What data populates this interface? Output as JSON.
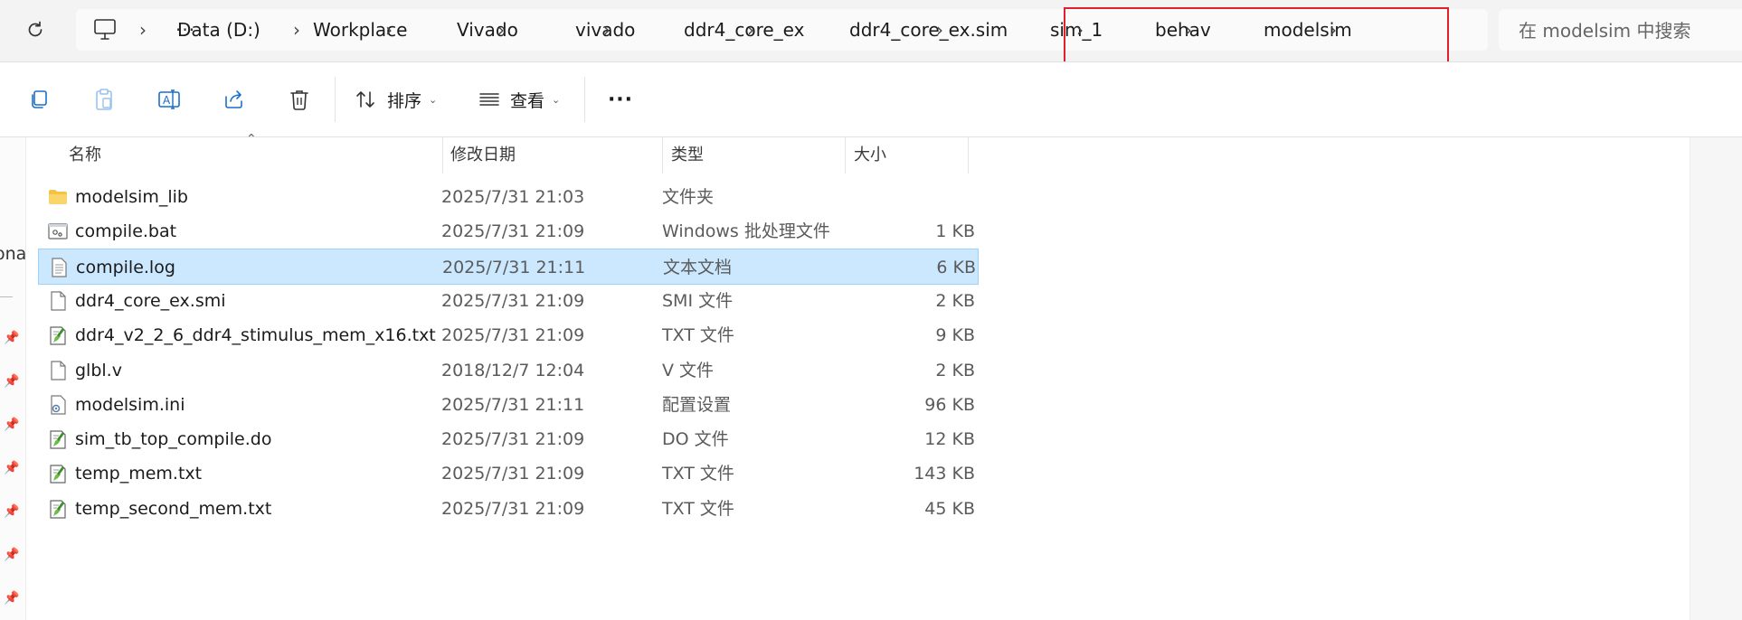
{
  "address": {
    "items": [
      "Data (D:)",
      "Workplace",
      "Vivado",
      "vivado",
      "ddr4_core_ex",
      "ddr4_core_ex.sim",
      "sim_1",
      "behav",
      "modelsim"
    ],
    "more": "···"
  },
  "search": {
    "placeholder": "在 modelsim 中搜索"
  },
  "toolbar": {
    "sort_label": "排序",
    "view_label": "查看",
    "more_label": "···"
  },
  "left_partial_text": "ona",
  "columns": {
    "name": "名称",
    "date": "修改日期",
    "type": "类型",
    "size": "大小"
  },
  "files": [
    {
      "name": "modelsim_lib",
      "date": "2025/7/31 21:03",
      "type": "文件夹",
      "size": "",
      "icon": "folder-icon"
    },
    {
      "name": "compile.bat",
      "date": "2025/7/31 21:09",
      "type": "Windows 批处理文件",
      "size": "1 KB",
      "icon": "batch-file-icon"
    },
    {
      "name": "compile.log",
      "date": "2025/7/31 21:11",
      "type": "文本文档",
      "size": "6 KB",
      "icon": "text-document-icon"
    },
    {
      "name": "ddr4_core_ex.smi",
      "date": "2025/7/31 21:09",
      "type": "SMI 文件",
      "size": "2 KB",
      "icon": "generic-file-icon"
    },
    {
      "name": "ddr4_v2_2_6_ddr4_stimulus_mem_x16.txt",
      "date": "2025/7/31 21:09",
      "type": "TXT 文件",
      "size": "9 KB",
      "icon": "notepadpp-file-icon"
    },
    {
      "name": "glbl.v",
      "date": "2018/12/7 12:04",
      "type": "V 文件",
      "size": "2 KB",
      "icon": "generic-file-icon"
    },
    {
      "name": "modelsim.ini",
      "date": "2025/7/31 21:11",
      "type": "配置设置",
      "size": "96 KB",
      "icon": "config-file-icon"
    },
    {
      "name": "sim_tb_top_compile.do",
      "date": "2025/7/31 21:09",
      "type": "DO 文件",
      "size": "12 KB",
      "icon": "notepadpp-file-icon"
    },
    {
      "name": "temp_mem.txt",
      "date": "2025/7/31 21:09",
      "type": "TXT 文件",
      "size": "143 KB",
      "icon": "notepadpp-file-icon"
    },
    {
      "name": "temp_second_mem.txt",
      "date": "2025/7/31 21:09",
      "type": "TXT 文件",
      "size": "45 KB",
      "icon": "notepadpp-file-icon"
    }
  ],
  "selected_index": 2,
  "colors": {
    "selection_bg": "#cce8ff",
    "selection_border": "#99d1ff",
    "highlight_box": "#e0202a",
    "folder": "#f5c342"
  }
}
